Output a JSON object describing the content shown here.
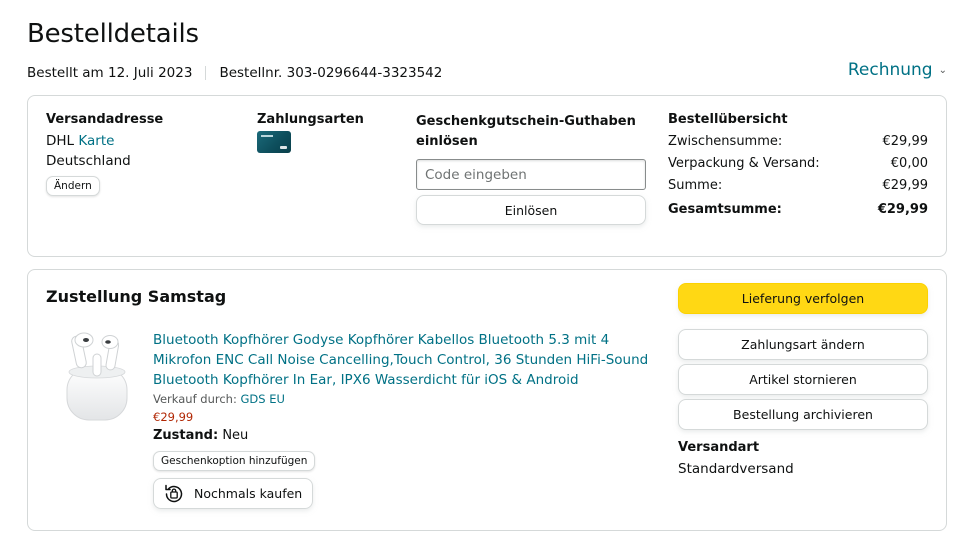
{
  "page": {
    "title": "Bestelldetails",
    "ordered_on": "Bestellt am 12. Juli 2023",
    "order_number": "Bestellnr. 303-0296644-3323542",
    "invoice_label": "Rechnung"
  },
  "shipping": {
    "heading": "Versandadresse",
    "carrier": "DHL",
    "map_link": "Karte",
    "country": "Deutschland",
    "change_label": "Ändern"
  },
  "payment": {
    "heading": "Zahlungsarten",
    "card_icon": "credit-card-icon"
  },
  "gift": {
    "heading": "Geschenkgutschein-Guthaben einlösen",
    "placeholder": "Code eingeben",
    "redeem_label": "Einlösen"
  },
  "summary": {
    "heading": "Bestellübersicht",
    "rows": [
      {
        "label": "Zwischensumme:",
        "value": "€29,99"
      },
      {
        "label": "Verpackung & Versand:",
        "value": "€0,00"
      },
      {
        "label": "Summe:",
        "value": "€29,99"
      }
    ],
    "total_label": "Gesamtsumme:",
    "total_value": "€29,99"
  },
  "delivery": {
    "heading": "Zustellung Samstag",
    "product": {
      "title": "Bluetooth Kopfhörer Godyse Kopfhörer Kabellos Bluetooth 5.3 mit 4 Mikrofon ENC Call Noise Cancelling,Touch Control, 36 Stunden HiFi-Sound Bluetooth Kopfhörer In Ear, IPX6 Wasserdicht für iOS & Android",
      "seller_prefix": "Verkauf durch:",
      "seller": "GDS EU",
      "price": "€29,99",
      "condition_label": "Zustand:",
      "condition": "Neu",
      "gift_option": "Geschenkoption hinzufügen",
      "buy_again": "Nochmals kaufen"
    },
    "actions": {
      "track": "Lieferung verfolgen",
      "change_payment": "Zahlungsart ändern",
      "cancel": "Artikel stornieren",
      "archive": "Bestellung archivieren"
    },
    "shipping_method_label": "Versandart",
    "shipping_method": "Standardversand"
  },
  "colors": {
    "link": "#007185",
    "price": "#B12704",
    "primary_button": "#FFD814",
    "border": "#D5D9D9"
  }
}
